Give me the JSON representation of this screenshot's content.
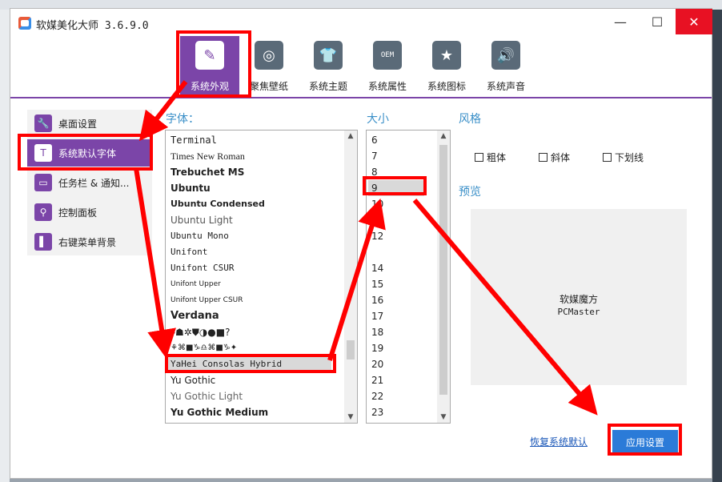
{
  "window": {
    "title": "软媒美化大师 3.6.9.0",
    "minimize_icon": "—",
    "maximize_icon": "☐",
    "close_icon": "✕"
  },
  "tabs": [
    {
      "label": "系统外观",
      "icon": "brush-icon",
      "active": true
    },
    {
      "label": "聚焦壁纸",
      "icon": "target-icon",
      "active": false
    },
    {
      "label": "系统主题",
      "icon": "tshirt-icon",
      "active": false
    },
    {
      "label": "系统属性",
      "icon": "oem-icon",
      "active": false
    },
    {
      "label": "系统图标",
      "icon": "star-icon",
      "active": false
    },
    {
      "label": "系统声音",
      "icon": "speaker-icon",
      "active": false
    }
  ],
  "sidebar": {
    "items": [
      {
        "label": "桌面设置",
        "icon": "wrench-icon",
        "active": false
      },
      {
        "label": "系统默认字体",
        "icon": "font-icon",
        "active": true
      },
      {
        "label": "任务栏 & 通知...",
        "icon": "taskbar-icon",
        "active": false
      },
      {
        "label": "控制面板",
        "icon": "magnifier-icon",
        "active": false
      },
      {
        "label": "右键菜单背景",
        "icon": "context-menu-icon",
        "active": false
      }
    ]
  },
  "font_section": {
    "label": "字体：",
    "items": [
      "Terminal",
      "Times New Roman",
      "Trebuchet MS",
      "Ubuntu",
      "Ubuntu Condensed",
      "Ubuntu Light",
      "Ubuntu Mono",
      "Unifont",
      "Unifont CSUR",
      "Unifont Upper",
      "Unifont Upper CSUR",
      "Verdana",
      "▸☗✲⛊◑●■?",
      "⚘⌘■♑♎⌘■♑✦",
      "YaHei Consolas Hybrid",
      "Yu Gothic",
      "Yu Gothic Light",
      "Yu Gothic Medium"
    ],
    "selected": "YaHei Consolas Hybrid"
  },
  "size_section": {
    "label": "大小",
    "items": [
      "6",
      "7",
      "8",
      "9",
      "10",
      "11",
      "12",
      "14",
      "15",
      "16",
      "17",
      "18",
      "19",
      "20",
      "21",
      "22",
      "23"
    ],
    "selected": "9"
  },
  "style_section": {
    "label": "风格",
    "options": [
      {
        "label": "粗体",
        "checked": false
      },
      {
        "label": "斜体",
        "checked": false
      },
      {
        "label": "下划线",
        "checked": false
      }
    ]
  },
  "preview_section": {
    "label": "预览",
    "line1": "软媒魔方",
    "line2": "PCMaster"
  },
  "actions": {
    "restore": "恢复系统默认",
    "apply": "应用设置"
  },
  "colors": {
    "accent": "#7b45a8",
    "apply_button": "#2b7bd8",
    "annotation": "#ff0000"
  }
}
